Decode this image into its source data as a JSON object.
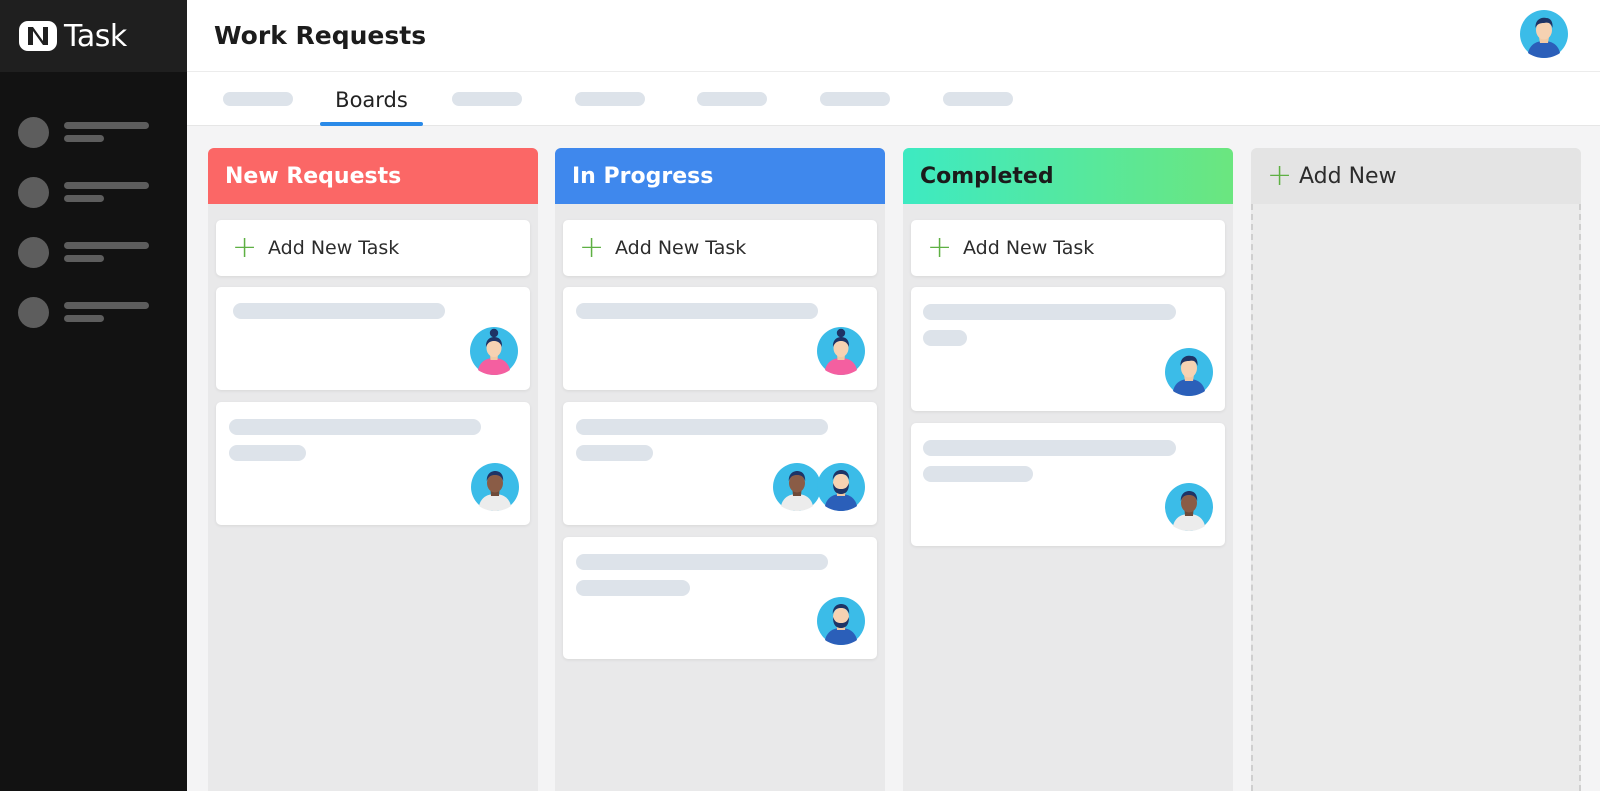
{
  "app": {
    "name": "Task"
  },
  "header": {
    "title": "Work Requests",
    "avatar_icon": "user-avatar-icon"
  },
  "tabs": {
    "active_label": "Boards",
    "accent_color": "#2a8ae8"
  },
  "columns": [
    {
      "title": "New Requests",
      "color": "#fb6766",
      "add_label": "Add New Task"
    },
    {
      "title": "In Progress",
      "color": "#3f88ed",
      "add_label": "Add New Task"
    },
    {
      "title": "Completed",
      "color": "#3deac2",
      "add_label": "Add New Task"
    }
  ],
  "add_column": {
    "label": "Add New",
    "icon": "plus-icon",
    "plus_color": "#5eb043"
  }
}
